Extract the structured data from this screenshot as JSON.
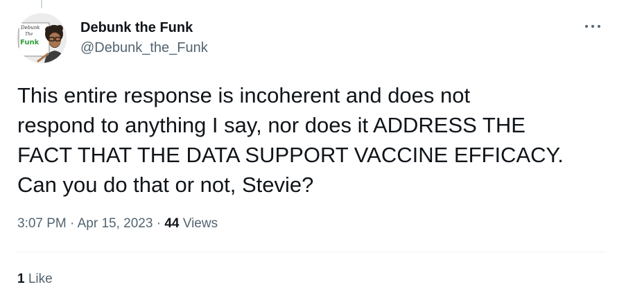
{
  "tweet": {
    "author": {
      "display_name": "Debunk the Funk",
      "handle": "@Debunk_the_Funk",
      "avatar_text": [
        "Debunk",
        "The",
        "Funk"
      ]
    },
    "text": "This entire response is incoherent and does not\nrespond to anything I say, nor does it ADDRESS THE\nFACT THAT THE DATA SUPPORT VACCINE EFFICACY.\nCan you do that or not, Stevie?",
    "time": "3:07 PM",
    "separator": "·",
    "date": "Apr 15, 2023",
    "views_count": "44",
    "views_label": "Views",
    "likes_count": "1",
    "likes_label": "Like"
  },
  "icons": {
    "more": "more-horizontal-icon"
  },
  "colors": {
    "text_primary": "#0f1419",
    "text_secondary": "#536471",
    "divider": "#eff3f4",
    "logo_green": "#2e9e3a"
  }
}
